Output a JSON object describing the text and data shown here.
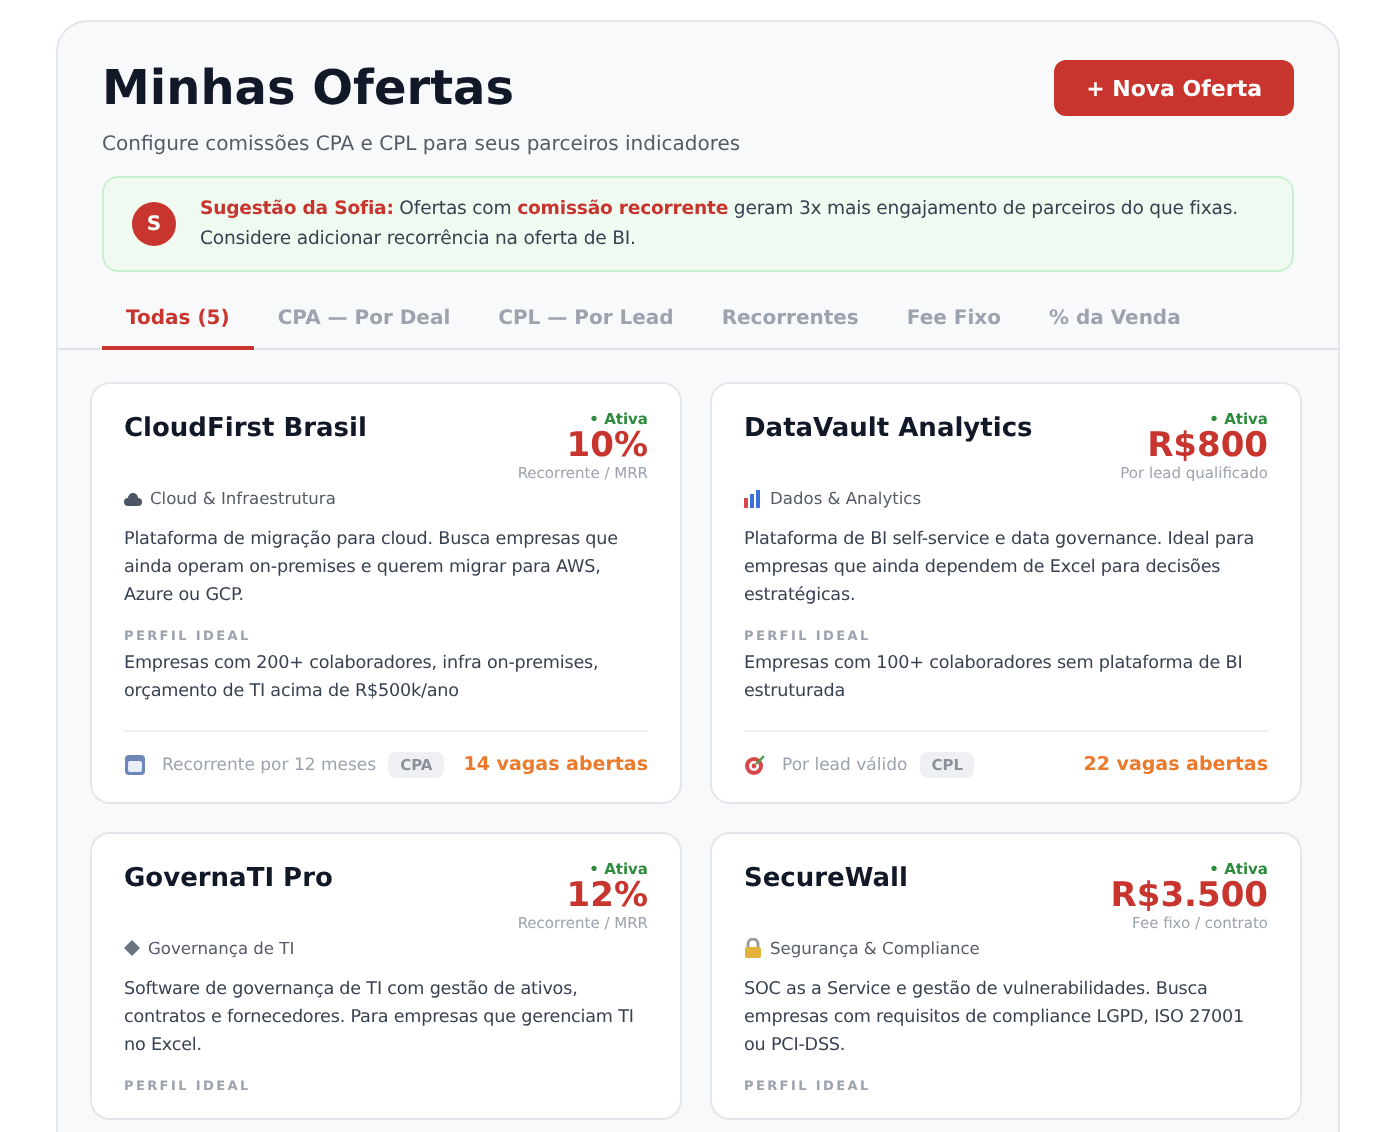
{
  "header": {
    "title": "Minhas Ofertas",
    "subtitle": "Configure comissões CPA e CPL para seus parceiros indicadores",
    "button": "+ Nova Oferta"
  },
  "suggestion": {
    "avatar": "S",
    "text": "**Sugestão da Sofia:** Ofertas com **comissão recorrente** geram 3x mais engajamento de parceiros do que fixas. Considere adicionar recorrência na oferta de BI."
  },
  "tabs": [
    {
      "label": "Todas (5)",
      "selected": true
    },
    {
      "label": "CPA — Por Deal",
      "selected": false
    },
    {
      "label": "CPL — Por Lead",
      "selected": false
    },
    {
      "label": "Recorrentes",
      "selected": false
    },
    {
      "label": "Fee Fixo",
      "selected": false
    },
    {
      "label": "% da Venda",
      "selected": false
    }
  ],
  "offers": [
    {
      "name": "CloudFirst Brasil",
      "status": "• Ativa",
      "active": true,
      "value": "10%",
      "value_note": "Recorrente / MRR",
      "category": "Cloud & Infraestrutura",
      "kind": "cloud",
      "description": "Plataforma de migração para cloud. Busca empresas que ainda operam on-premises e querem migrar para AWS, Azure ou GCP.",
      "ideal_label": "PERFIL IDEAL",
      "ideal": "Empresas com 200+ colaboradores, infra on-premises, orçamento de TI acima de R$500k/ano",
      "footer": {
        "kind": "calendar",
        "note": "Recorrente por 12 meses",
        "tag": "CPA",
        "slots": "14 vagas abertas"
      }
    },
    {
      "name": "DataVault Analytics",
      "status": "• Ativa",
      "active": true,
      "value": "R$800",
      "value_note": "Por lead qualificado",
      "category": "Dados & Analytics",
      "kind": "chart",
      "description": "Plataforma de BI self-service e data governance. Ideal para empresas que ainda dependem de Excel para decisões estratégicas.",
      "ideal_label": "PERFIL IDEAL",
      "ideal": "Empresas com 100+ colaboradores sem plataforma de BI estruturada",
      "footer": {
        "kind": "target",
        "note": "Por lead válido",
        "tag": "CPL",
        "slots": "22 vagas abertas"
      }
    },
    {
      "name": "GovernaTI Pro",
      "status": "• Ativa",
      "active": true,
      "value": "12%",
      "value_note": "Recorrente / MRR",
      "category": "Governança de TI",
      "kind": "diamond",
      "description": "Software de governança de TI com gestão de ativos, contratos e fornecedores. Para empresas que gerenciam TI no Excel.",
      "ideal_label": "PERFIL IDEAL"
    },
    {
      "name": "SecureWall",
      "status": "• Ativa",
      "active": true,
      "value": "R$3.500",
      "value_note": "Fee fixo / contrato",
      "category": "Segurança & Compliance",
      "kind": "lock",
      "description": "SOC as a Service e gestão de vulnerabilidades. Busca empresas com requisitos de compliance LGPD, ISO 27001 ou PCI-DSS.",
      "ideal_label": "PERFIL IDEAL"
    }
  ]
}
